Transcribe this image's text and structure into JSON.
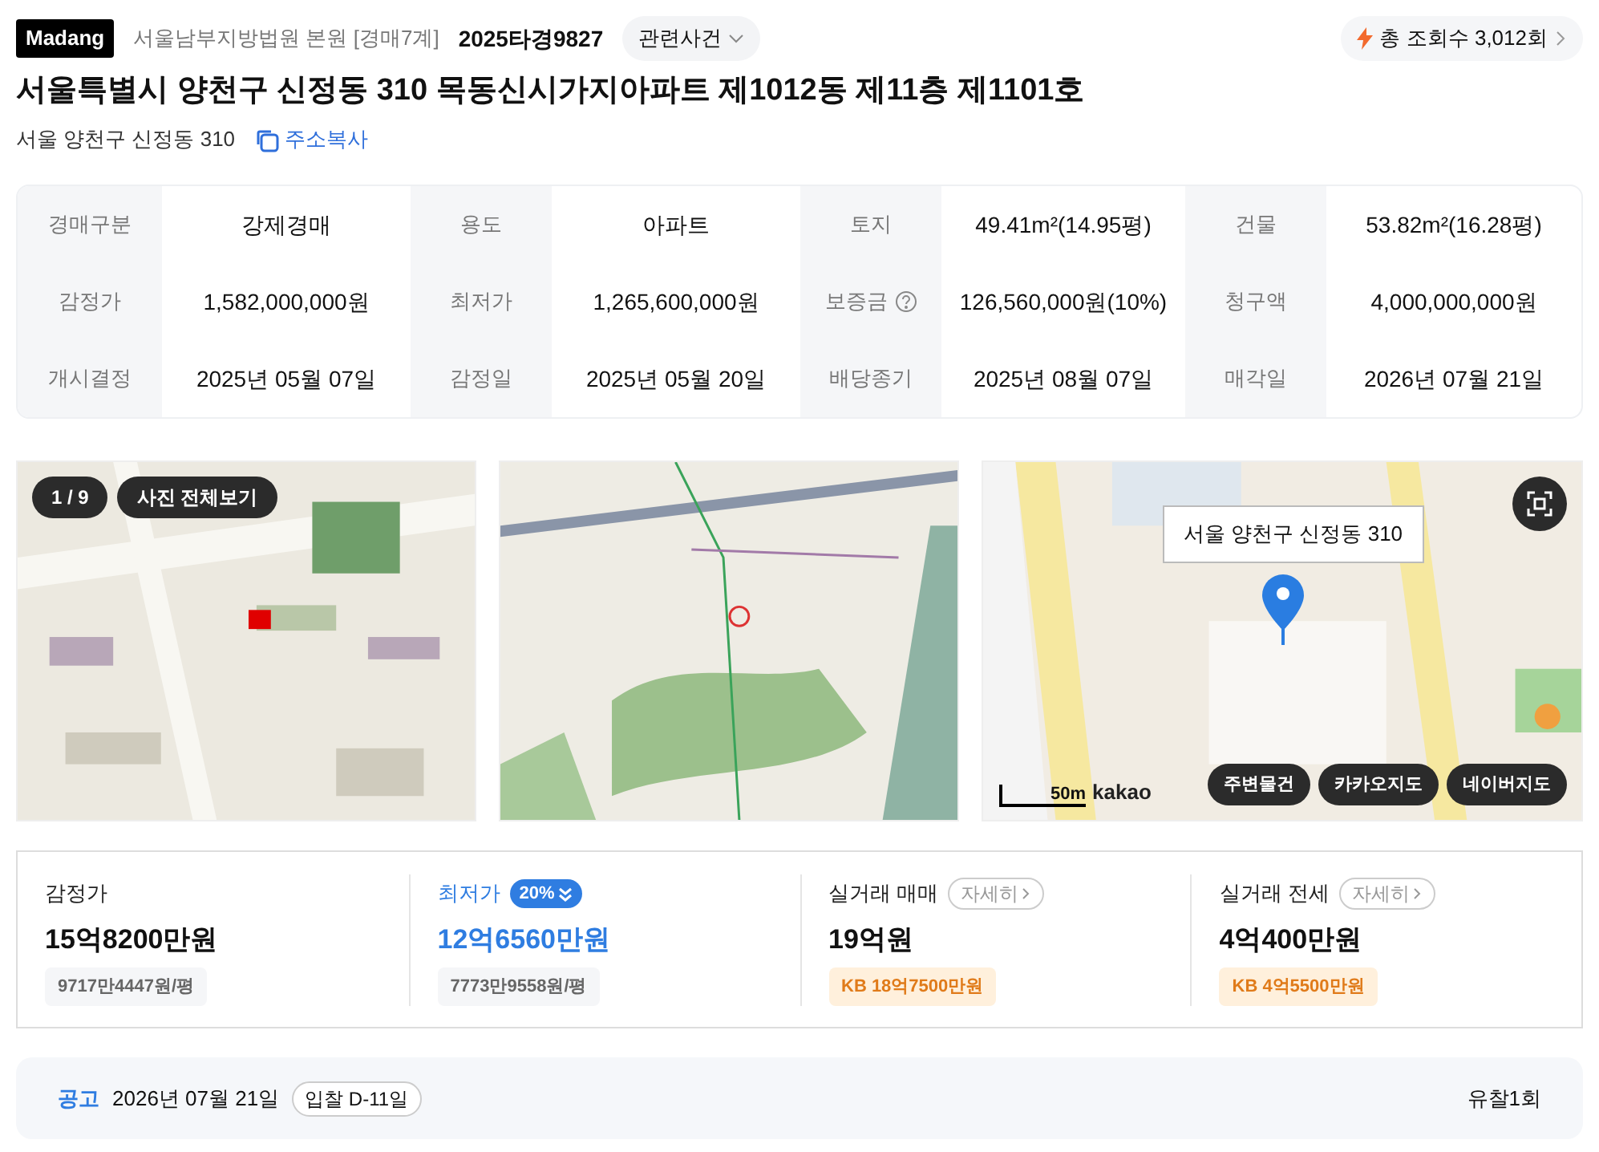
{
  "header": {
    "brand": "Madang",
    "court": "서울남부지방법원 본원 [경매7계]",
    "case_no": "2025타경9827",
    "related": "관련사건",
    "views": "총 조회수 3,012회"
  },
  "title": "서울특별시 양천구 신정동 310 목동신시가지아파트 제1012동 제11층 제1101호",
  "address": {
    "text": "서울 양천구 신정동 310",
    "copy": "주소복사"
  },
  "info": [
    [
      {
        "label": "경매구분",
        "value": "강제경매"
      },
      {
        "label": "용도",
        "value": "아파트"
      },
      {
        "label": "토지",
        "value": "49.41m²(14.95평)"
      },
      {
        "label": "건물",
        "value": "53.82m²(16.28평)"
      }
    ],
    [
      {
        "label": "감정가",
        "value": "1,582,000,000원"
      },
      {
        "label": "최저가",
        "value": "1,265,600,000원"
      },
      {
        "label": "보증금",
        "value": "126,560,000원(10%)",
        "help": true
      },
      {
        "label": "청구액",
        "value": "4,000,000,000원"
      }
    ],
    [
      {
        "label": "개시결정",
        "value": "2025년 05월 07일"
      },
      {
        "label": "감정일",
        "value": "2025년 05월 20일"
      },
      {
        "label": "배당종기",
        "value": "2025년 08월 07일"
      },
      {
        "label": "매각일",
        "value": "2026년 07월 21일"
      }
    ]
  ],
  "photos": {
    "counter": "1 / 9",
    "view_all": "사진 전체보기"
  },
  "map": {
    "tooltip": "서울 양천구 신정동 310",
    "scale": "50m",
    "attribution": "kakao",
    "buttons": [
      "주변물건",
      "카카오지도",
      "네이버지도"
    ]
  },
  "prices": [
    {
      "label": "감정가",
      "value": "15억8200만원",
      "sub": "9717만4447원/평",
      "kind": "plain"
    },
    {
      "label": "최저가",
      "badge": "20%",
      "value": "12억6560만원",
      "sub": "7773만9558원/평",
      "kind": "highlight"
    },
    {
      "label": "실거래 매매",
      "link": "자세히",
      "value": "19억원",
      "sub": "KB 18억7500만원",
      "kind": "kb"
    },
    {
      "label": "실거래 전세",
      "link": "자세히",
      "value": "4억400만원",
      "sub": "KB 4억5500만원",
      "kind": "kb"
    }
  ],
  "notice": {
    "label": "공고",
    "date": "2026년 07월 21일",
    "dday": "입찰 D-11일",
    "result": "유찰1회"
  }
}
